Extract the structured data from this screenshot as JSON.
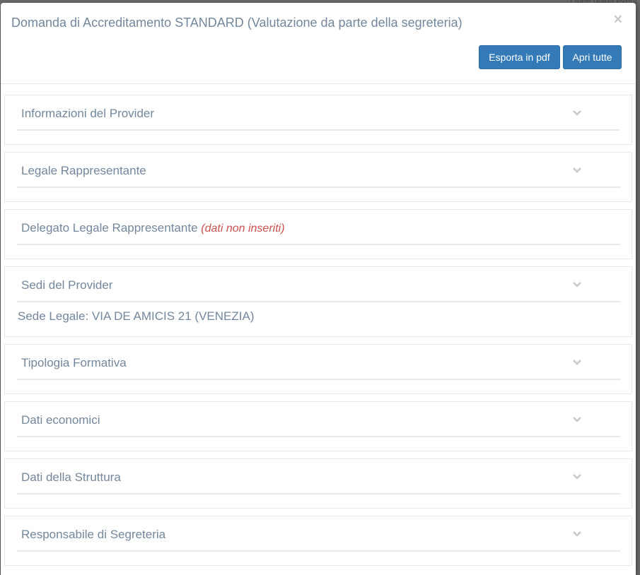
{
  "background": {
    "peek_text": "Linee guida event"
  },
  "modal": {
    "title": "Domanda di Accreditamento STANDARD (Valutazione da parte della segreteria)",
    "close_symbol": "×",
    "buttons": {
      "export_pdf": "Esporta in pdf",
      "open_all": "Apri tutte"
    }
  },
  "panels": [
    {
      "title": "Informazioni del Provider",
      "icon": "chevron-down-icon"
    },
    {
      "title": "Legale Rappresentante",
      "icon": "chevron-down-icon"
    },
    {
      "title": "Delegato Legale Rappresentante",
      "note": "(dati non inseriti)"
    },
    {
      "title": "Sedi del Provider",
      "icon": "chevron-down-icon",
      "body": "Sede Legale: VIA DE AMICIS 21 (VENEZIA)"
    },
    {
      "title": "Tipologia Formativa",
      "icon": "chevron-down-icon"
    },
    {
      "title": "Dati economici",
      "icon": "chevron-down-icon"
    },
    {
      "title": "Dati della Struttura",
      "icon": "chevron-down-icon"
    },
    {
      "title": "Responsabile di Segreteria",
      "icon": "chevron-down-icon"
    }
  ],
  "colors": {
    "primary": "#337ab7",
    "text": "#73879c",
    "note": "#c9514f",
    "border": "#e6e9ed"
  }
}
